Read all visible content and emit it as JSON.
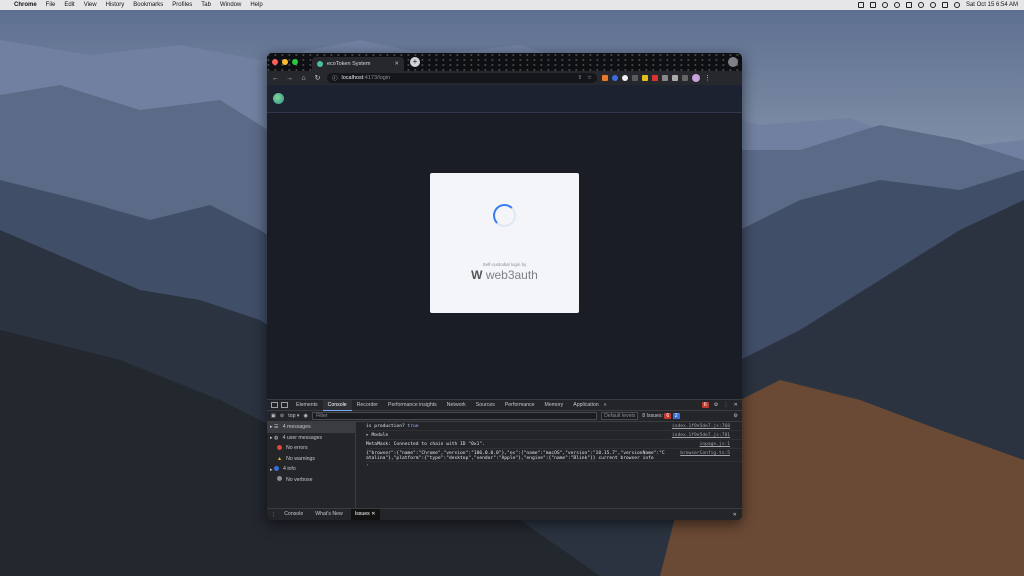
{
  "menubar": {
    "app": "Chrome",
    "items": [
      "File",
      "Edit",
      "View",
      "History",
      "Bookmarks",
      "Profiles",
      "Tab",
      "Window",
      "Help"
    ],
    "clock": "Sat Oct 15  6:54 AM"
  },
  "browser": {
    "tab_title": "ecoToken System",
    "url_host": "localhost",
    "url_path": ":4173/login"
  },
  "login_modal": {
    "powered_by": "Self-custodial login by",
    "brand": "web3auth"
  },
  "devtools": {
    "tabs": [
      "Elements",
      "Console",
      "Recorder",
      "Performance insights",
      "Network",
      "Sources",
      "Performance",
      "Memory",
      "Application"
    ],
    "active_tab": "Console",
    "error_count": "6",
    "context": "top",
    "filter_placeholder": "Filter",
    "levels": "Default levels",
    "issues": "8 Issues:",
    "issues_err": "6",
    "issues_info": "2",
    "sidebar": [
      {
        "label": "4 messages",
        "icon": "list-icon"
      },
      {
        "label": "4 user messages",
        "icon": "user-icon"
      },
      {
        "label": "No errors",
        "icon": "error-icon"
      },
      {
        "label": "No warnings",
        "icon": "warning-icon"
      },
      {
        "label": "4 info",
        "icon": "info-icon"
      },
      {
        "label": "No verbose",
        "icon": "verbose-icon"
      }
    ],
    "log": [
      {
        "text": "is production? ",
        "kw": "true",
        "src": "index.1f9e5de7.js:768"
      },
      {
        "text": "▸ Module",
        "kw": "",
        "src": "index.1f9e5de7.js:781"
      },
      {
        "text": "MetaMask: Connected to chain with ID \"0x1\".",
        "kw": "",
        "src": "inpage.js:1"
      },
      {
        "text": "{\"browser\":{\"name\":\"Chrome\",\"version\":\"106.0.0.0\"},\"os\":{\"name\":\"macOS\",\"version\":\"10.15.7\",\"versionName\":\"Catalina\"},\"platform\":{\"type\":\"desktop\",\"vendor\":\"Apple\"},\"engine\":{\"name\":\"Blink\"}} current browser info",
        "kw": "",
        "src": "browserConfig.ts:5"
      }
    ],
    "drawer_tabs": [
      "Console",
      "What's New",
      "Issues"
    ]
  }
}
